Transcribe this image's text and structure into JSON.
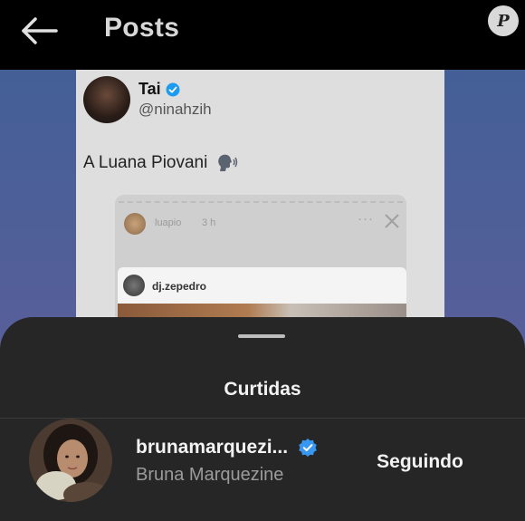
{
  "header": {
    "title": "Posts",
    "watermark_letter": "P"
  },
  "post": {
    "author_name": "Tai",
    "author_handle": "@ninahzih",
    "text": "A Luana Piovani",
    "embedded_story": {
      "user": "luapio",
      "time": "3 h",
      "more": "···",
      "inner_post_user": "dj.zepedro"
    }
  },
  "likes_sheet": {
    "title": "Curtidas",
    "users": [
      {
        "username": "brunamarquezi...",
        "full_name": "Bruna Marquezine",
        "follow_label": "Seguindo"
      }
    ]
  },
  "colors": {
    "header_bg": "#000000",
    "sheet_bg": "#262626",
    "verified_blue": "#3897f0",
    "background_gradient_top": "#3f5f96",
    "background_gradient_bottom": "#5a5f9a"
  }
}
